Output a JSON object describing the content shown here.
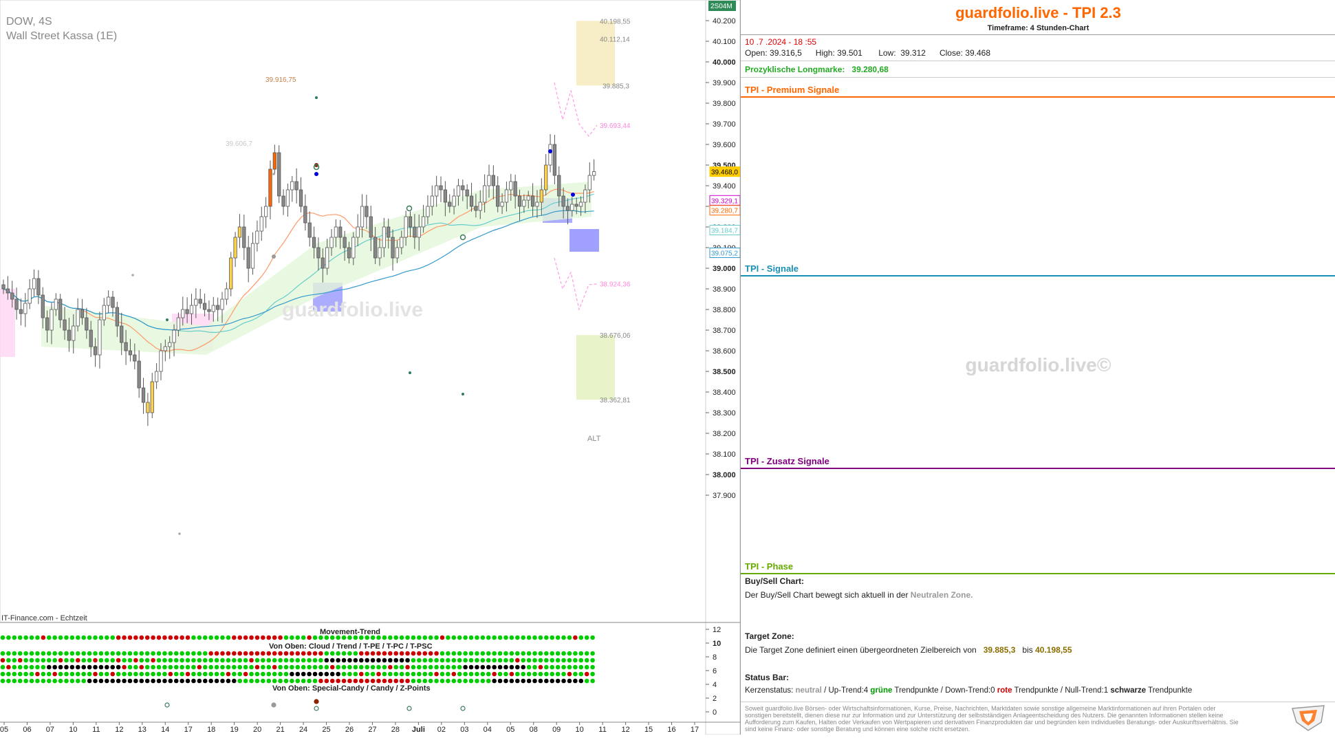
{
  "chart": {
    "symbol_line": "DOW, 4S",
    "instrument": "Wall Street Kassa (1E)",
    "source": "IT-Finance.com - Echtzeit",
    "watermark": "guardfolio.live",
    "scale_badge": "2S04M",
    "zone_label": "ALT",
    "colors": {
      "up": "#ffffff",
      "down": "#888888",
      "orange": "#ff6600",
      "yellow": "#ffd24d",
      "blue_box": "#8080ff",
      "target_zone": "#f5e9b8",
      "alt_zone": "#e6f2c4",
      "pink_line": "#ff88dd",
      "green_ma": "#66cccc",
      "salmon_ma": "#ff9966"
    }
  },
  "chart_data": {
    "type": "candlestick",
    "ylim": [
      37850,
      40300
    ],
    "y_ticks": [
      "40.200",
      "40.100",
      "40.000",
      "39.900",
      "39.800",
      "39.700",
      "39.600",
      "39.500",
      "39.400",
      "39.300",
      "39.200",
      "39.100",
      "39.000",
      "38.900",
      "38.800",
      "38.700",
      "38.600",
      "38.500",
      "38.400",
      "38.300",
      "38.200",
      "38.100",
      "38.000",
      "37.900"
    ],
    "y_tick_values": [
      40200,
      40100,
      40000,
      39900,
      39800,
      39700,
      39600,
      39500,
      39400,
      39300,
      39200,
      39100,
      39000,
      38900,
      38800,
      38700,
      38600,
      38500,
      38400,
      38300,
      38200,
      38100,
      38000,
      37900
    ],
    "x_labels": [
      "05",
      "06",
      "07",
      "10",
      "11",
      "12",
      "13",
      "14",
      "17",
      "18",
      "19",
      "20",
      "21",
      "24",
      "25",
      "26",
      "27",
      "28",
      "Juli",
      "02",
      "03",
      "04",
      "05",
      "08",
      "09",
      "10",
      "11",
      "12",
      "15",
      "16",
      "17"
    ],
    "price_tags": [
      {
        "label": "39.468,0",
        "value": 39468,
        "color": "#ffcc00"
      },
      {
        "label": "39.329,1",
        "value": 39329,
        "color": "#cc00cc"
      },
      {
        "label": "39.280,7",
        "value": 39281,
        "color": "#ff6600"
      },
      {
        "label": "39.184,7",
        "value": 39185,
        "color": "#66cccc"
      },
      {
        "label": "39.075,2",
        "value": 39075,
        "color": "#3399cc"
      }
    ],
    "annotations": [
      {
        "label": "40.198,55",
        "value": 40198.55
      },
      {
        "label": "40.112,14",
        "value": 40112.14
      },
      {
        "label": "39.885,3",
        "value": 39885.3
      },
      {
        "label": "39.693,44",
        "value": 39693.44
      },
      {
        "label": "39.916,75",
        "value": 39916.75
      },
      {
        "label": "39.606,7",
        "value": 39606.7
      },
      {
        "label": "38.924,36",
        "value": 38924.36
      },
      {
        "label": "38.676,06",
        "value": 38676.06
      },
      {
        "label": "38.362,81",
        "value": 38362.81
      }
    ],
    "target_zone": [
      39885.3,
      40198.55
    ],
    "alt_zone": [
      38362.81,
      38676.06
    ],
    "closes": [
      38900,
      38880,
      38850,
      38800,
      38780,
      38830,
      38900,
      38950,
      38870,
      38760,
      38700,
      38800,
      38850,
      38750,
      38700,
      38650,
      38720,
      38800,
      38760,
      38700,
      38620,
      38580,
      38750,
      38820,
      38860,
      38810,
      38720,
      38640,
      38600,
      38580,
      38550,
      38420,
      38350,
      38300,
      38450,
      38500,
      38600,
      38620,
      38640,
      38700,
      38760,
      38800,
      38780,
      38820,
      38850,
      38830,
      38800,
      38790,
      38820,
      38800,
      38850,
      38900,
      39050,
      39150,
      39200,
      39100,
      39000,
      39120,
      39180,
      39250,
      39300,
      39480,
      39560,
      39350,
      39300,
      39380,
      39420,
      39380,
      39300,
      39220,
      39150,
      39100,
      39050,
      39000,
      39100,
      39150,
      39200,
      39150,
      39100,
      39050,
      39150,
      39200,
      39300,
      39250,
      39150,
      39050,
      39100,
      39200,
      39150,
      39050,
      39100,
      39150,
      39250,
      39200,
      39150,
      39200,
      39250,
      39300,
      39350,
      39400,
      39380,
      39320,
      39300,
      39350,
      39400,
      39380,
      39350,
      39300,
      39280,
      39320,
      39400,
      39450,
      39400,
      39300,
      39320,
      39380,
      39420,
      39350,
      39300,
      39330,
      39350,
      39300,
      39320,
      39380,
      39500,
      39600,
      39450,
      39350,
      39300,
      39280,
      39310,
      39300,
      39320,
      39380,
      39450,
      39468
    ]
  },
  "indicator": {
    "title": "Movement-Trend",
    "sub1": "Von Oben: Cloud / Trend / T-PE / T-PC / T-PSC",
    "sub2": "Von Oben: Special-Candy / Candy / Z-Points",
    "y_ticks": [
      "12",
      "10",
      "8",
      "6",
      "4",
      "2",
      "0"
    ]
  },
  "panel": {
    "title": "guardfolio.live - TPI 2.3",
    "timeframe": "Timeframe: 4 Stunden-Chart",
    "datetime": "10 .7 .2024  - 18 :55",
    "open_label": "Open:",
    "open": "39.316,5",
    "high_label": "High:",
    "high": "39.501",
    "low_label": "Low:",
    "low": "39.312",
    "close_label": "Close:",
    "close": "39.468",
    "longmark_label": "Prozyklische Longmarke:",
    "longmark": "39.280,68",
    "sec_premium": "TPI - Premium Signale",
    "sec_signale": "TPI - Signale",
    "sec_zusatz": "TPI - Zusatz Signale",
    "sec_phase": "TPI - Phase",
    "watermark": "guardfolio.live©",
    "buysell_title": "Buy/Sell Chart:",
    "buysell_text": "Der Buy/Sell Chart bewegt sich aktuell in der",
    "buysell_zone": "Neutralen Zone.",
    "target_title": "Target Zone:",
    "target_text": "Die Target Zone definiert einen übergeordneten Zielbereich von",
    "target_from": "39.885,3",
    "target_bis": "bis",
    "target_to": "40.198,55",
    "status_title": "Status Bar:",
    "status_kerzen": "Kerzenstatus:",
    "status_neutral": "neutral",
    "status_up": "/ Up-Trend:4",
    "status_gruene": "grüne",
    "status_tp1": "Trendpunkte",
    "status_down": "/ Down-Trend:0",
    "status_rote": "rote",
    "status_tp2": "Trendpunkte",
    "status_null": "/ Null-Trend:1",
    "status_schwarze": "schwarze",
    "status_tp3": "Trendpunkte",
    "disclaimer": "Soweit guardfolio.live Börsen- oder Wirtschaftsinformationen, Kurse, Preise, Nachrichten, Marktdaten sowie sonstige allgemeine Marktinformationen auf ihren Portalen oder sonstigen bereitstellt, dienen diese nur zur Information und zur Unterstützung der selbstständigen Anlageentscheidung des Nutzers. Die genannten Informationen stellen keine Aufforderung zum Kaufen, Halten oder Verkaufen von Wertpapieren und derivativen Finanzprodukten dar und begründen kein individuelles Beratungs- oder Auskunftsverhältnis. Sie sind keine Finanz- oder sonstige Beratung und können eine solche nicht ersetzen.",
    "colors": {
      "premium": "#ff6600",
      "signale": "#1a8fb5",
      "zusatz": "#800080",
      "phase": "#66aa00",
      "green": "#009900",
      "red": "#cc0000",
      "neutral": "#999999",
      "gold": "#8a6d00"
    }
  }
}
